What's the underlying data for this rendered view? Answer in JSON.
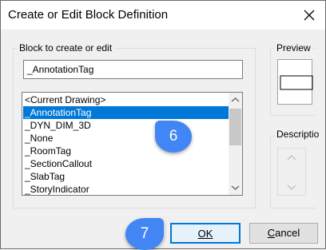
{
  "window": {
    "title": "Create or Edit Block Definition"
  },
  "block_group": {
    "label": "Block to create or edit",
    "input_value": "_AnnotationTag"
  },
  "list": {
    "items": [
      "<Current Drawing>",
      "_AnnotationTag",
      "_DYN_DIM_3D",
      "_None",
      "_RoomTag",
      "_SectionCallout",
      "_SlabTag",
      "_StoryIndicator"
    ],
    "selected_index": 1
  },
  "preview": {
    "label": "Preview"
  },
  "description": {
    "label": "Descriptio"
  },
  "buttons": {
    "ok": "OK",
    "cancel_underlined": "C",
    "cancel_rest": "ancel"
  },
  "callouts": {
    "step_list": "6",
    "step_ok": "7"
  },
  "colors": {
    "selection": "#0078d7",
    "callout": "#4285f4",
    "default_button_border": "#0078d7"
  }
}
